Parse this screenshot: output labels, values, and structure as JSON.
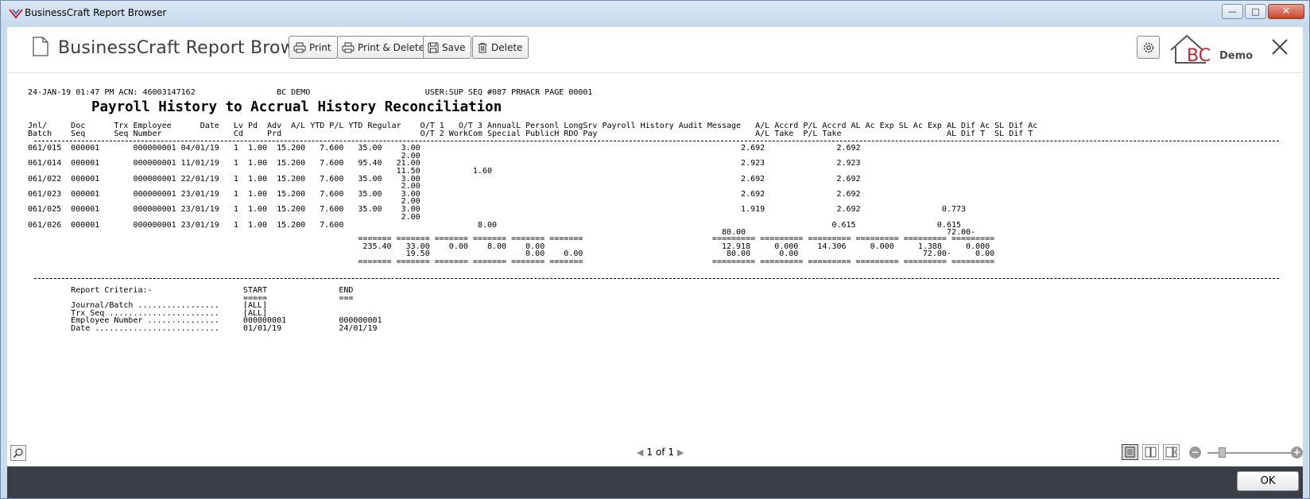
{
  "window": {
    "title": "BusinessCraft Report Browser"
  },
  "toolbar": {
    "app_title": "BusinessCraft Report Browser",
    "print_label": "Print",
    "print_delete_label": "Print & Delete",
    "save_label": "Save",
    "delete_label": "Delete",
    "logo_text": "BC",
    "demo_label": "Demo"
  },
  "report": {
    "header_line": "24-JAN-19 01:47 PM ACN: 46003147162                 BC DEMO                        USER:SUP SEQ #087 PRHACR PAGE 00001",
    "title": "Payroll History to Accrual History Reconciliation",
    "col_header_1": "Jnl/     Doc      Trx Employee      Date   Lv Pd  Adv  A/L YTD P/L YTD Regular    O/T 1   O/T 3 AnnualL Personl LongSrv Payroll History Audit Message   A/L Accrd P/L Accrd AL Ac Exp SL Ac Exp AL Dif Ac SL Dif Ac",
    "col_header_2": "Batch    Seq      Seq Number               Cd     Prd                             O/T 2 WorkCom Special PublicH RDO Pay                                 A/L Take  P/L Take                      AL Dif T  SL Dif T",
    "rows": [
      "061/015  000001       000000001 04/01/19   1  1.00  15.200   7.600   35.00    3.00                                                                   2.692               2.692",
      "                                                                              2.00",
      "061/014  000001       000000001 11/01/19   1  1.00  15.200   7.600   95.40   21.00                                                                   2.923               2.923",
      "                                                                             11.50           1.60",
      "061/022  000001       000000001 22/01/19   1  1.00  15.200   7.600   35.00    3.00                                                                   2.692               2.692",
      "                                                                              2.00",
      "061/023  000001       000000001 23/01/19   1  1.00  15.200   7.600   35.00    3.00                                                                   2.692               2.692",
      "                                                                              2.00",
      "061/025  000001       000000001 23/01/19   1  1.00  15.200   7.600   35.00    3.00                                                                   1.919               2.692                 0.773",
      "                                                                              2.00",
      "061/026  000001       000000001 23/01/19   1  1.00  15.200   7.600                            8.00                                                                      0.615                 0.615",
      "                                                                                                                                                 80.00                                          72.00-"
    ],
    "totals": [
      "                                                                     ======= ======= ======= ======= ======= =======                           ========= ========= ========= ========= ========= =========",
      "                                                                      235.40   33.00    0.00    8.00    0.00                                     12.918     0.000    14.306     0.000     1.388     0.000",
      "                                                                               19.50                    0.00    0.00                              80.00      0.00                          72.00-     0.00",
      "                                                                     ======= ======= ======= ======= ======= =======                           ========= ========= ========= ========= ========= ========="
    ],
    "criteria": [
      "         Report Criteria:-                   START               END",
      "                                             =====               ===",
      "         Journal/Batch .................     [ALL]",
      "         Trx Seq .......................     [ALL]",
      "         Employee Number ...............     000000001           000000001",
      "         Date ..........................     01/01/19            24/01/19"
    ]
  },
  "pager": {
    "current": "1",
    "of_label": "of",
    "total": "1"
  },
  "footer": {
    "ok_label": "OK"
  }
}
